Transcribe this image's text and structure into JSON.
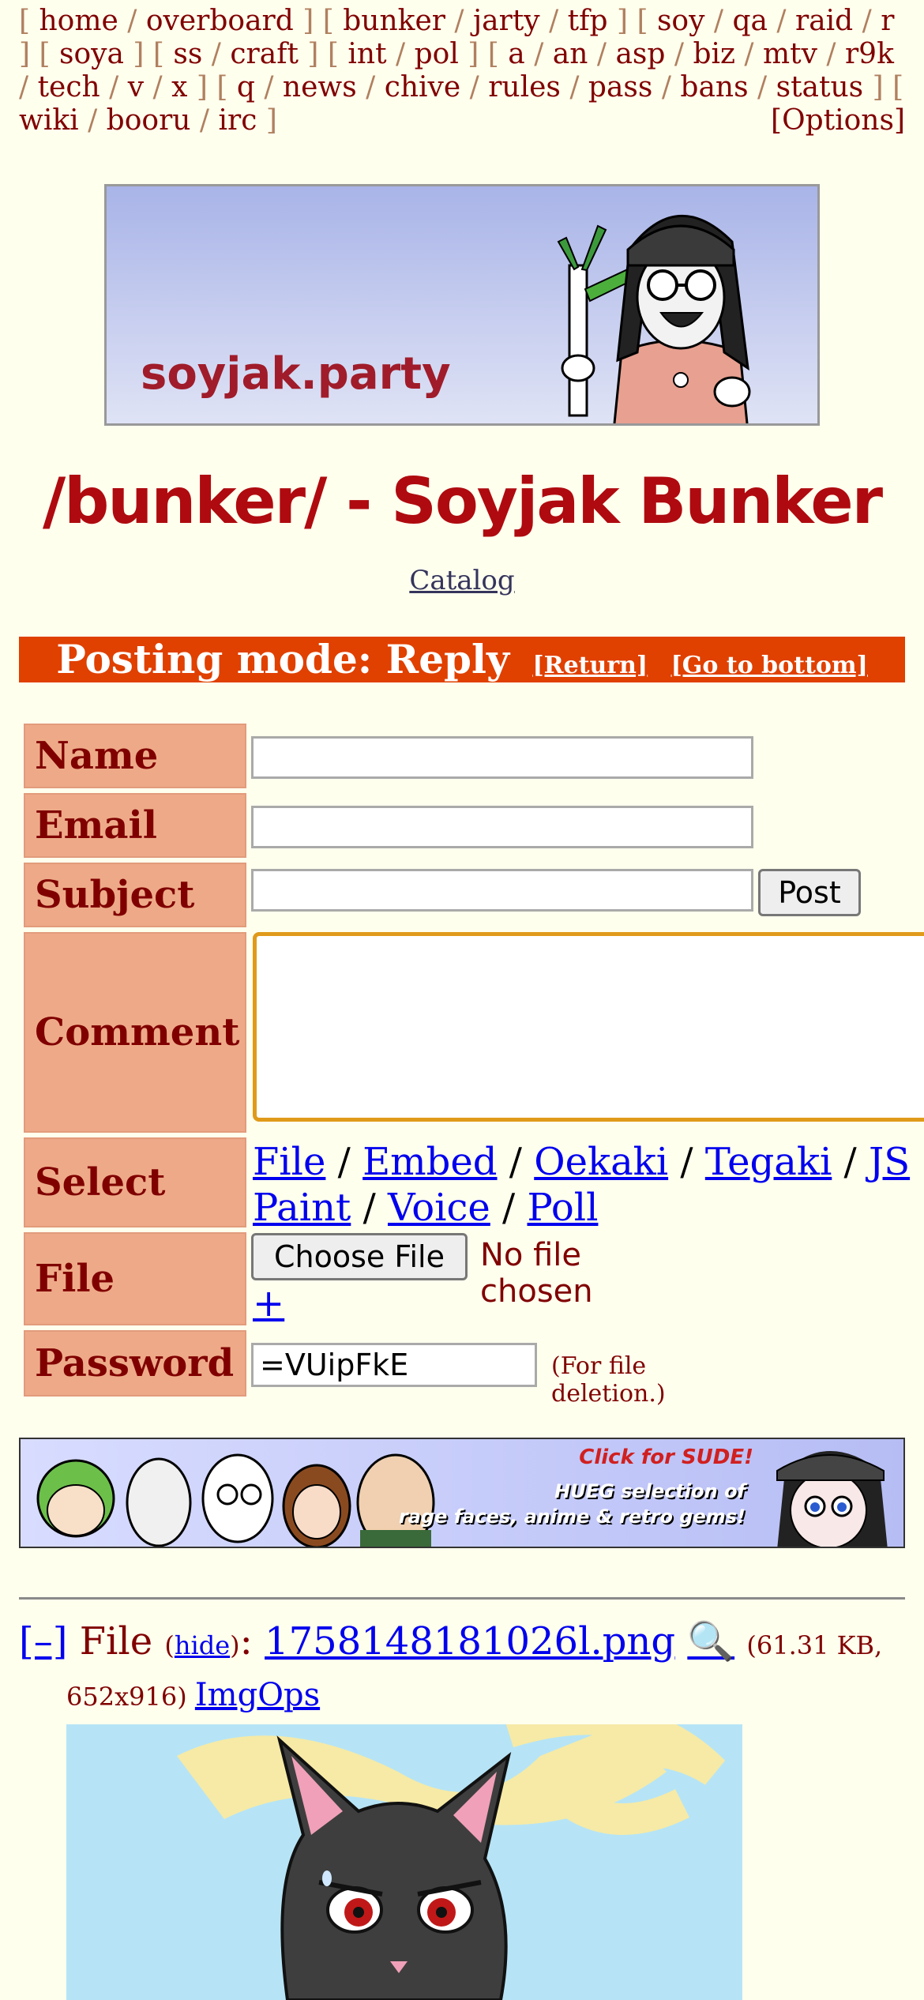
{
  "boardlist": {
    "groups": [
      [
        "home",
        "overboard"
      ],
      [
        "bunker",
        "jarty",
        "tfp"
      ],
      [
        "soy",
        "qa",
        "raid",
        "r"
      ],
      [
        "soya"
      ],
      [
        "ss",
        "craft"
      ],
      [
        "int",
        "pol"
      ],
      [
        "a",
        "an",
        "asp",
        "biz",
        "mtv",
        "r9k",
        "tech",
        "v",
        "x"
      ],
      [
        "q",
        "news",
        "chive",
        "rules",
        "pass",
        "bans",
        "status"
      ],
      [
        "wiki",
        "booru",
        "irc"
      ]
    ],
    "options": "[Options]"
  },
  "banner": {
    "text": "soyjak.party"
  },
  "title": "/bunker/ - Soyjak Bunker",
  "catalog": "Catalog",
  "posting_mode": {
    "label": "Posting mode: Reply",
    "return": "[Return]",
    "bottom": "[Go to bottom]"
  },
  "form": {
    "name_label": "Name",
    "email_label": "Email",
    "subject_label": "Subject",
    "post_button": "Post",
    "comment_label": "Comment",
    "select_label": "Select",
    "select_links": [
      "File",
      "Embed",
      "Oekaki",
      "Tegaki",
      "JS Paint",
      "Voice",
      "Poll"
    ],
    "file_label": "File",
    "choose_file": "Choose File",
    "no_file": "No file chosen",
    "plus": "+",
    "password_label": "Password",
    "password_value": "=VUipFkE",
    "password_hint": "(For file deletion.)"
  },
  "ad": {
    "line1": "Click for SUDE!",
    "line2": "HUEG selection of",
    "line3": "rage faces, anime & retro gems!"
  },
  "post": {
    "collapse": "[–]",
    "file_word": "File",
    "hide": "hide",
    "filename": "1758148181026l.png",
    "search_icon": "🔍",
    "size": "(61.31 KB,",
    "dims": "652x916)",
    "imgops": "ImgOps"
  },
  "colors": {
    "accent": "#e04000",
    "label_bg": "#eeaa88",
    "text": "#800000",
    "link": "#0000ee",
    "background": "#ffffee"
  }
}
